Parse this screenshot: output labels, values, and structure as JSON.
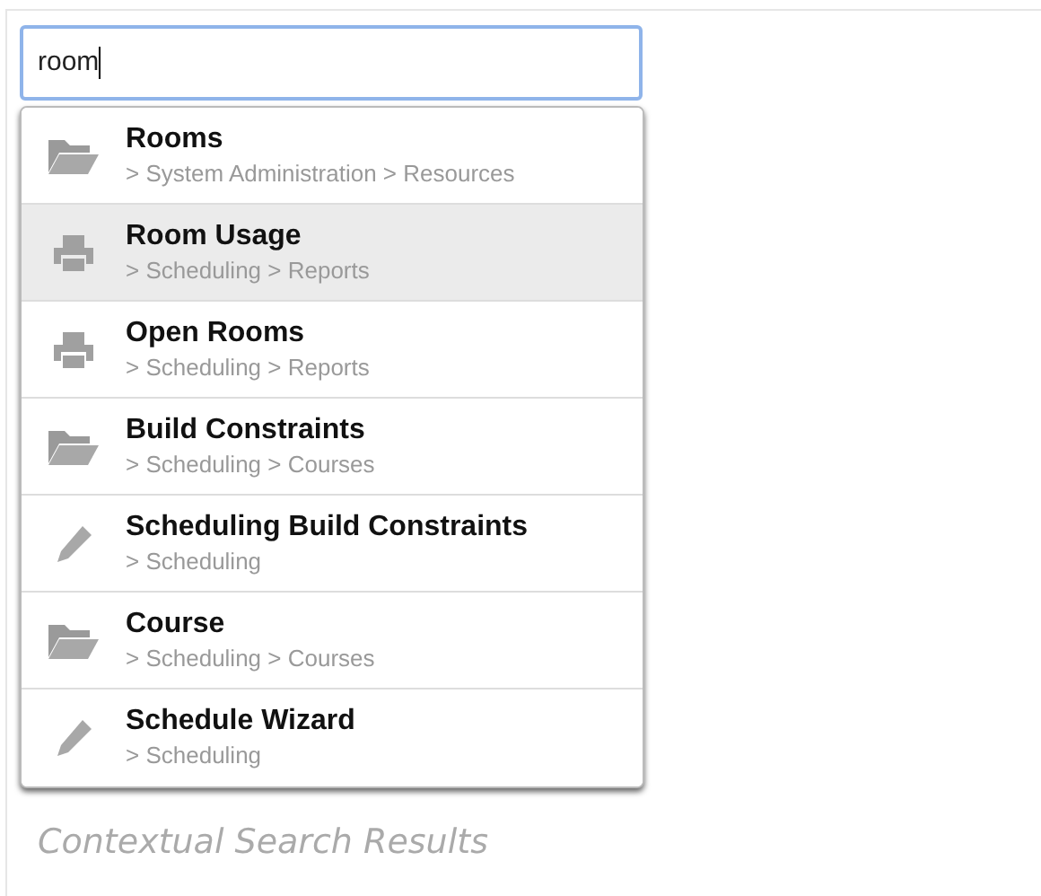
{
  "search": {
    "value": "room"
  },
  "results": [
    {
      "title": "Rooms",
      "path": "> System Administration > Resources",
      "kind": "folder",
      "selected": false
    },
    {
      "title": "Room Usage",
      "path": "> Scheduling > Reports",
      "kind": "report",
      "selected": true
    },
    {
      "title": "Open Rooms",
      "path": "> Scheduling > Reports",
      "kind": "report",
      "selected": false
    },
    {
      "title": "Build Constraints",
      "path": "> Scheduling > Courses",
      "kind": "folder",
      "selected": false
    },
    {
      "title": "Scheduling Build Constraints",
      "path": "> Scheduling",
      "kind": "edit",
      "selected": false
    },
    {
      "title": "Course",
      "path": "> Scheduling > Courses",
      "kind": "folder",
      "selected": false
    },
    {
      "title": "Schedule Wizard",
      "path": "> Scheduling",
      "kind": "edit",
      "selected": false
    }
  ],
  "caption": "Contextual Search Results"
}
